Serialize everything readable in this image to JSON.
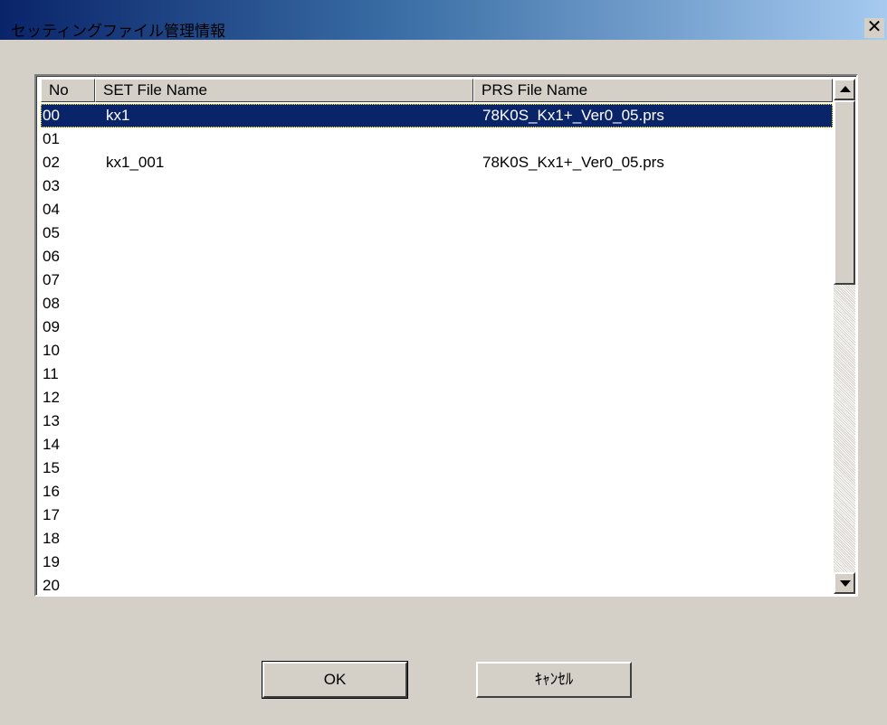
{
  "window": {
    "title": "セッティングファイル管理情報",
    "close_glyph": "✕"
  },
  "list": {
    "columns": [
      "No",
      "SET File Name",
      "PRS File Name"
    ],
    "rows": [
      {
        "no": "00",
        "set": "kx1",
        "prs": "78K0S_Kx1+_Ver0_05.prs",
        "selected": true
      },
      {
        "no": "01",
        "set": "",
        "prs": ""
      },
      {
        "no": "02",
        "set": "kx1_001",
        "prs": "78K0S_Kx1+_Ver0_05.prs"
      },
      {
        "no": "03",
        "set": "",
        "prs": ""
      },
      {
        "no": "04",
        "set": "",
        "prs": ""
      },
      {
        "no": "05",
        "set": "",
        "prs": ""
      },
      {
        "no": "06",
        "set": "",
        "prs": ""
      },
      {
        "no": "07",
        "set": "",
        "prs": ""
      },
      {
        "no": "08",
        "set": "",
        "prs": ""
      },
      {
        "no": "09",
        "set": "",
        "prs": ""
      },
      {
        "no": "10",
        "set": "",
        "prs": ""
      },
      {
        "no": "11",
        "set": "",
        "prs": ""
      },
      {
        "no": "12",
        "set": "",
        "prs": ""
      },
      {
        "no": "13",
        "set": "",
        "prs": ""
      },
      {
        "no": "14",
        "set": "",
        "prs": ""
      },
      {
        "no": "15",
        "set": "",
        "prs": ""
      },
      {
        "no": "16",
        "set": "",
        "prs": ""
      },
      {
        "no": "17",
        "set": "",
        "prs": ""
      },
      {
        "no": "18",
        "set": "",
        "prs": ""
      },
      {
        "no": "19",
        "set": "",
        "prs": ""
      },
      {
        "no": "20",
        "set": "",
        "prs": ""
      }
    ]
  },
  "buttons": {
    "ok_label": "OK",
    "cancel_label": "ｷｬﾝｾﾙ"
  },
  "colors": {
    "title_gradient_start": "#0a246a",
    "title_gradient_end": "#a6caf0",
    "selection": "#0a246a",
    "face": "#d4d0c8"
  }
}
